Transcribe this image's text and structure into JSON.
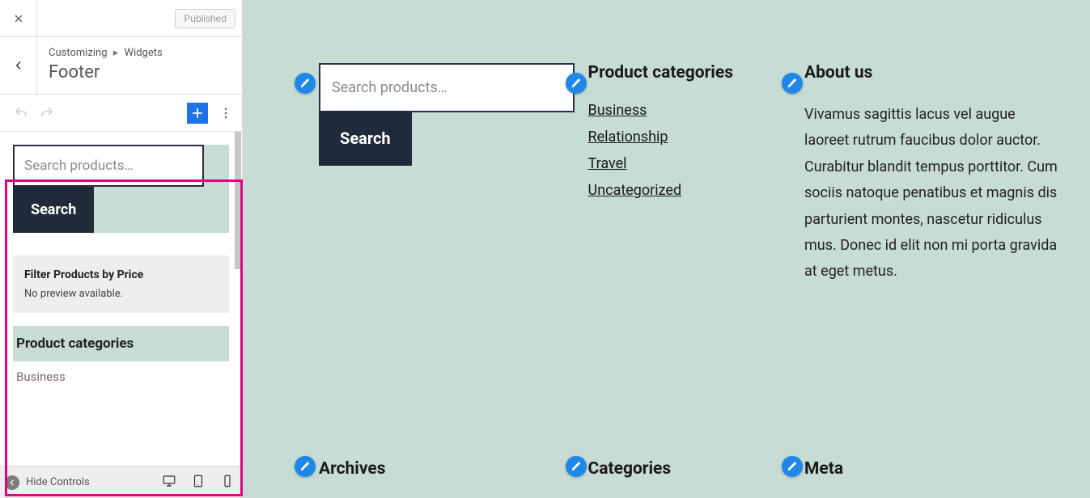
{
  "customizer": {
    "publish_label": "Published",
    "breadcrumb_parent": "Customizing",
    "breadcrumb_child": "Widgets",
    "section_title": "Footer",
    "hide_controls_label": "Hide Controls"
  },
  "sidebar_widgets": {
    "search": {
      "placeholder": "Search products…",
      "button_label": "Search"
    },
    "filter_block": {
      "title": "Filter Products by Price",
      "subtitle": "No preview available."
    },
    "product_categories": {
      "heading": "Product categories",
      "items": [
        "Business"
      ]
    }
  },
  "preview": {
    "search": {
      "placeholder": "Search products…",
      "button_label": "Search"
    },
    "product_categories": {
      "heading": "Product categories",
      "links": [
        "Business",
        "Relationship",
        "Travel",
        "Uncategorized"
      ]
    },
    "about_us": {
      "heading": "About us",
      "body": "Vivamus sagittis lacus vel augue laoreet rutrum faucibus dolor auctor. Curabitur blandit tempus porttitor. Cum sociis natoque penatibus et magnis dis parturient montes, nascetur ridiculus mus. Donec id elit non mi porta gravida at eget metus."
    },
    "row2": {
      "archives_heading": "Archives",
      "categories_heading": "Categories",
      "meta_heading": "Meta"
    }
  }
}
